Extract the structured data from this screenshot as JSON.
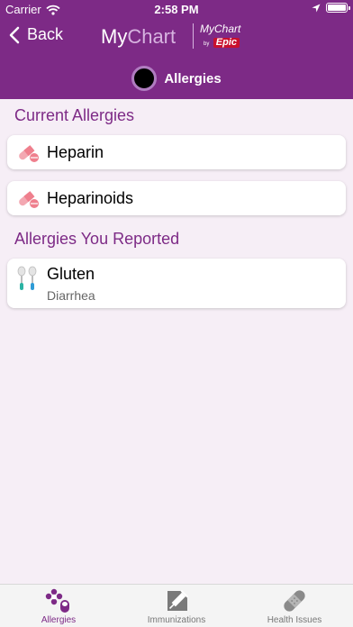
{
  "status_bar": {
    "carrier": "Carrier",
    "time": "2:58 PM"
  },
  "nav": {
    "back_label": "Back",
    "logo_my": "My",
    "logo_chart": "Chart",
    "brand_top": "MyChart",
    "brand_by": "by",
    "brand_epic": "Epic"
  },
  "page": {
    "title": "Allergies"
  },
  "sections": {
    "current": {
      "title": "Current Allergies",
      "items": [
        {
          "name": "Heparin",
          "icon": "pill-icon"
        },
        {
          "name": "Heparinoids",
          "icon": "pill-icon"
        }
      ]
    },
    "reported": {
      "title": "Allergies You Reported",
      "items": [
        {
          "name": "Gluten",
          "reaction": "Diarrhea",
          "icon": "food-allergy-icon"
        }
      ]
    }
  },
  "tabs": [
    {
      "label": "Allergies",
      "icon": "allergies-icon",
      "active": true
    },
    {
      "label": "Immunizations",
      "icon": "syringe-icon",
      "active": false
    },
    {
      "label": "Health Issues",
      "icon": "bandage-icon",
      "active": false
    }
  ],
  "colors": {
    "brand_purple": "#7d2a86",
    "background": "#f6eef6",
    "pill_pink": "#ef7f8d",
    "epic_red": "#c8102e"
  }
}
